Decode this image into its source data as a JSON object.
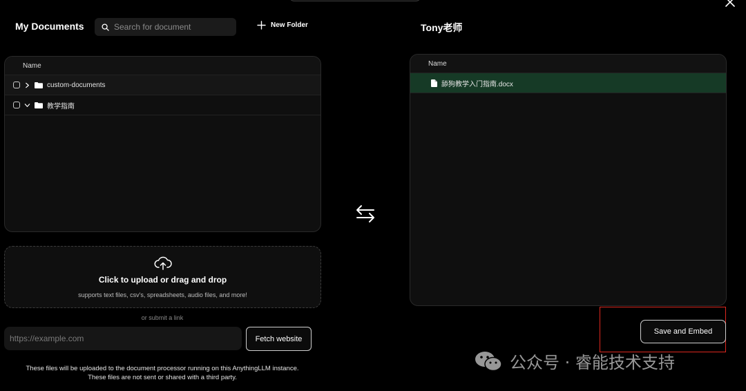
{
  "header": {
    "title": "My Documents",
    "search_placeholder": "Search for document",
    "new_folder_label": "New Folder"
  },
  "my_documents": {
    "column_name": "Name",
    "rows": [
      {
        "label": "custom-documents",
        "expanded": false
      },
      {
        "label": "教学指南",
        "expanded": true
      }
    ]
  },
  "upload": {
    "title": "Click to upload or drag and drop",
    "subtitle": "supports text files, csv's, spreadsheets, audio files, and more!",
    "or_link": "or submit a link",
    "url_placeholder": "https://example.com",
    "fetch_label": "Fetch website",
    "notice_line1": "These files will be uploaded to the document processor running on this AnythingLLM instance.",
    "notice_line2": "These files are not sent or shared with a third party."
  },
  "workspace": {
    "title": "Tony老师",
    "column_name": "Name",
    "files": [
      {
        "label": "舔狗教学入门指南.docx"
      }
    ],
    "save_label": "Save and Embed"
  },
  "watermark": {
    "text": "公众号 · 睿能技术支持"
  },
  "colors": {
    "background": "#000000",
    "panel": "#0f0f0f",
    "selected_row": "#163a26",
    "highlight": "#e0281f"
  },
  "icons": [
    "close-icon",
    "search-icon",
    "plus-icon",
    "chevron-right-icon",
    "chevron-down-icon",
    "folder-icon",
    "file-icon",
    "cloud-upload-icon",
    "swap-icon",
    "wechat-icon"
  ]
}
